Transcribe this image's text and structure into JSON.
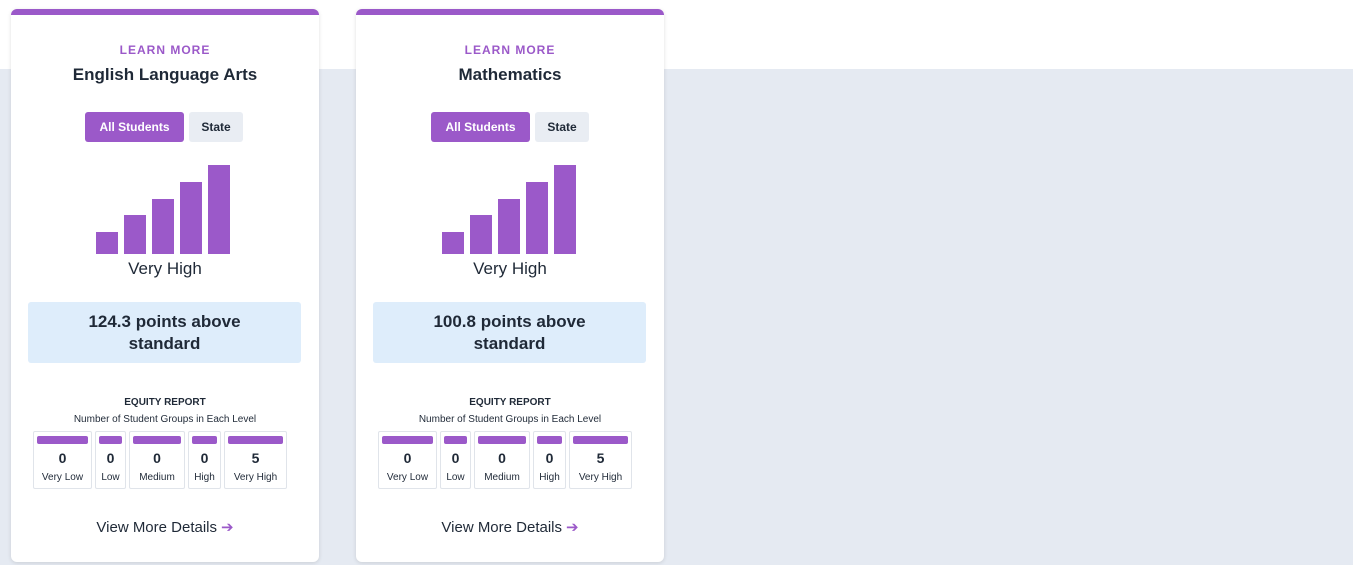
{
  "cards": [
    {
      "learn_more": "LEARN MORE",
      "subject": "English Language Arts",
      "toggle_all": "All Students",
      "toggle_state": "State",
      "level": "Very High",
      "points": "124.3 points above standard",
      "equity_title": "EQUITY REPORT",
      "equity_subtitle": "Number of Student Groups in Each Level",
      "equity": [
        {
          "count": "0",
          "label": "Very Low"
        },
        {
          "count": "0",
          "label": "Low"
        },
        {
          "count": "0",
          "label": "Medium"
        },
        {
          "count": "0",
          "label": "High"
        },
        {
          "count": "5",
          "label": "Very High"
        }
      ],
      "details_label": "View More Details",
      "arrow": "➔"
    },
    {
      "learn_more": "LEARN MORE",
      "subject": "Mathematics",
      "toggle_all": "All Students",
      "toggle_state": "State",
      "level": "Very High",
      "points": "100.8 points above standard",
      "equity_title": "EQUITY REPORT",
      "equity_subtitle": "Number of Student Groups in Each Level",
      "equity": [
        {
          "count": "0",
          "label": "Very Low"
        },
        {
          "count": "0",
          "label": "Low"
        },
        {
          "count": "0",
          "label": "Medium"
        },
        {
          "count": "0",
          "label": "High"
        },
        {
          "count": "5",
          "label": "Very High"
        }
      ],
      "details_label": "View More Details",
      "arrow": "➔"
    }
  ],
  "level_scale": {
    "levels": [
      "Very Low",
      "Low",
      "Medium",
      "High",
      "Very High"
    ],
    "current_level_index": 4
  },
  "colors": {
    "accent": "#9b59c9",
    "points_bg": "#deedfb",
    "page_bg": "#e5eaf2"
  },
  "icons": {
    "level_indicator": "bar-chart-icon",
    "details_arrow": "arrow-right-icon"
  }
}
